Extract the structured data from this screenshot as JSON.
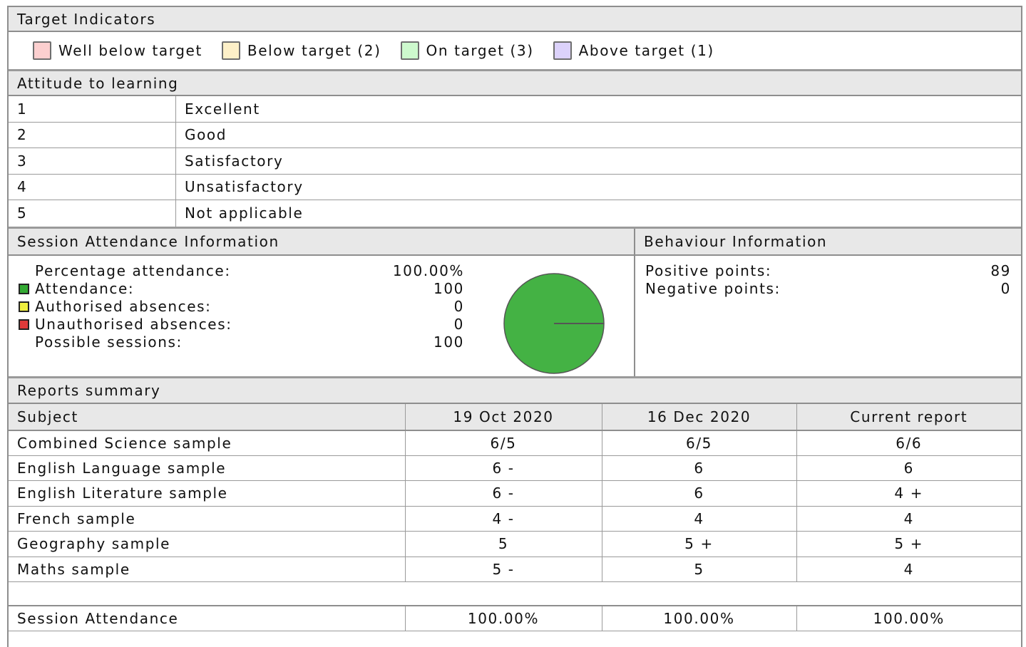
{
  "target_indicators": {
    "title": "Target Indicators",
    "legend": [
      {
        "label": "Well below target",
        "color": "#fccfcf"
      },
      {
        "label": "Below target (2)",
        "color": "#fdf0c8"
      },
      {
        "label": "On target (3)",
        "color": "#cdf9cd"
      },
      {
        "label": "Above target (1)",
        "color": "#dcd2fb"
      }
    ]
  },
  "attitude": {
    "title": "Attitude to learning",
    "rows": [
      {
        "num": "1",
        "label": "Excellent"
      },
      {
        "num": "2",
        "label": "Good"
      },
      {
        "num": "3",
        "label": "Satisfactory"
      },
      {
        "num": "4",
        "label": "Unsatisfactory"
      },
      {
        "num": "5",
        "label": "Not applicable"
      }
    ]
  },
  "attendance": {
    "title": "Session Attendance Information",
    "rows": [
      {
        "label": "Percentage attendance:",
        "value": "100.00%",
        "key_color": ""
      },
      {
        "label": "Attendance:",
        "value": "100",
        "key_color": "#33aa33"
      },
      {
        "label": "Authorised absences:",
        "value": "0",
        "key_color": "#f0f040"
      },
      {
        "label": "Unauthorised absences:",
        "value": "0",
        "key_color": "#e03a3a"
      },
      {
        "label": "Possible sessions:",
        "value": "100",
        "key_color": ""
      }
    ],
    "pie": {
      "slices": [
        {
          "name": "Attendance",
          "value": 100,
          "color": "#44b244"
        },
        {
          "name": "Authorised absences",
          "value": 0,
          "color": "#f0f040"
        },
        {
          "name": "Unauthorised absences",
          "value": 0,
          "color": "#e03a3a"
        }
      ]
    }
  },
  "behaviour": {
    "title": "Behaviour Information",
    "rows": [
      {
        "label": "Positive points:",
        "value": "89"
      },
      {
        "label": "Negative points:",
        "value": "0"
      }
    ]
  },
  "reports": {
    "title": "Reports summary",
    "columns": [
      "Subject",
      "19 Oct 2020",
      "16 Dec 2020",
      "Current report"
    ],
    "rows": [
      [
        "Combined Science sample",
        "6/5",
        "6/5",
        "6/6"
      ],
      [
        "English Language sample",
        "6 -",
        "6",
        "6"
      ],
      [
        "English Literature sample",
        "6 -",
        "6",
        "4 +"
      ],
      [
        "French sample",
        "4 -",
        "4",
        "4"
      ],
      [
        "Geography sample",
        "5",
        "5 +",
        "5 +"
      ],
      [
        "Maths sample",
        "5 -",
        "5",
        "4"
      ]
    ],
    "summary": [
      "Session Attendance",
      "100.00%",
      "100.00%",
      "100.00%"
    ]
  }
}
